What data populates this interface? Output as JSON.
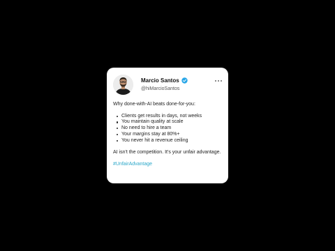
{
  "post": {
    "author_name": "Marcio Santos",
    "author_handle": "@hiMarcioSantos",
    "verified_color": "#2aa7e8",
    "intro": "Why done-with-AI beats done-for-you:",
    "bullets": [
      "Clients get results in days, not weeks",
      "You maintain quality at scale",
      "No need to hire a team",
      "Your margins stay at 80%+",
      "You never hit a revenue ceiling"
    ],
    "outro": "AI isn't the competition. It's your unfair advantage.",
    "hashtag": "#UnfairAdvantage",
    "hashtag_color": "#2aa7c9",
    "icons": {
      "avatar": "avatar-photo",
      "verified": "verified-badge-icon",
      "more": "more-options-icon"
    }
  }
}
